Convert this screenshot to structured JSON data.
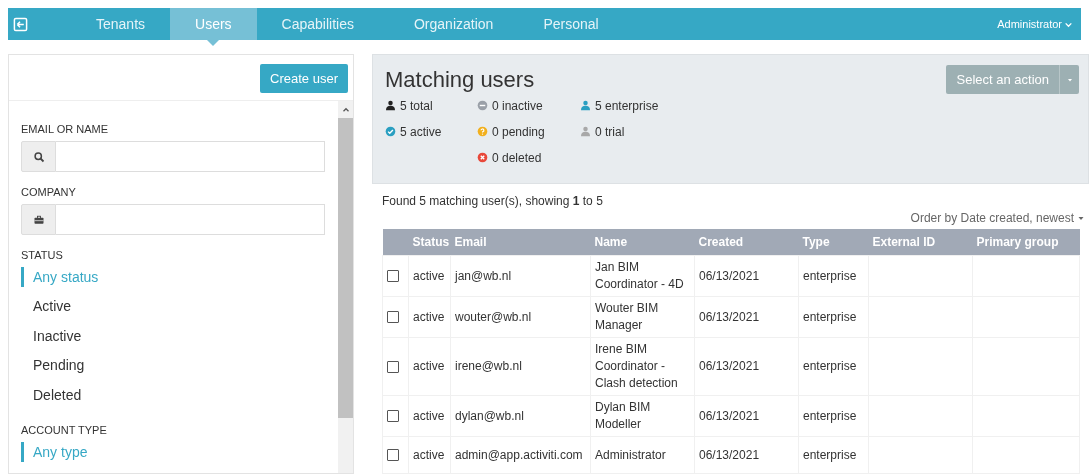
{
  "nav": {
    "tabs": [
      {
        "label": "Tenants",
        "selected": false
      },
      {
        "label": "Users",
        "selected": true
      },
      {
        "label": "Capabilities",
        "selected": false
      },
      {
        "label": "Organization",
        "selected": false
      },
      {
        "label": "Personal",
        "selected": false
      }
    ],
    "user_menu": "Administrator"
  },
  "sidebar": {
    "create_button": "Create user",
    "fields": [
      {
        "label": "EMAIL OR NAME",
        "kind": "search"
      },
      {
        "label": "COMPANY",
        "kind": "company"
      }
    ],
    "filters": [
      {
        "label": "STATUS",
        "options": [
          {
            "label": "Any status",
            "selected": true
          },
          {
            "label": "Active",
            "selected": false
          },
          {
            "label": "Inactive",
            "selected": false
          },
          {
            "label": "Pending",
            "selected": false
          },
          {
            "label": "Deleted",
            "selected": false
          }
        ]
      },
      {
        "label": "ACCOUNT TYPE",
        "options": [
          {
            "label": "Any type",
            "selected": true
          }
        ]
      }
    ]
  },
  "summary": {
    "title": "Matching users",
    "action_button": "Select an action",
    "stat_columns": [
      [
        {
          "kind": "total",
          "text": "5 total"
        },
        {
          "kind": "active",
          "text": "5 active"
        }
      ],
      [
        {
          "kind": "inactive",
          "text": "0 inactive"
        },
        {
          "kind": "pending",
          "text": "0 pending"
        },
        {
          "kind": "deleted",
          "text": "0 deleted"
        }
      ],
      [
        {
          "kind": "enterprise",
          "text": "5 enterprise"
        },
        {
          "kind": "trial",
          "text": "0 trial"
        }
      ]
    ]
  },
  "results": {
    "found": "Found 5 matching user(s), showing **1** to 5",
    "order": "Order by Date created, newest"
  },
  "table": {
    "columns": [
      "Status",
      "Email",
      "Name",
      "Created",
      "Type",
      "External ID",
      "Primary group"
    ],
    "rows": [
      {
        "checked": false,
        "cells": [
          "active",
          "jan@wb.nl",
          "Jan BIM Coordinator - 4D",
          "06/13/2021",
          "enterprise"
        ]
      },
      {
        "checked": false,
        "cells": [
          "active",
          "wouter@wb.nl",
          "Wouter BIM Manager",
          "06/13/2021",
          "enterprise"
        ]
      },
      {
        "checked": false,
        "cells": [
          "active",
          "irene@wb.nl",
          "Irene BIM Coordinator - Clash detection",
          "06/13/2021",
          "enterprise"
        ]
      },
      {
        "checked": false,
        "cells": [
          "active",
          "dylan@wb.nl",
          "Dylan BIM Modeller",
          "06/13/2021",
          "enterprise"
        ]
      },
      {
        "checked": false,
        "cells": [
          "active",
          "admin@app.activiti.com",
          "Administrator",
          "06/13/2021",
          "enterprise"
        ]
      }
    ]
  }
}
